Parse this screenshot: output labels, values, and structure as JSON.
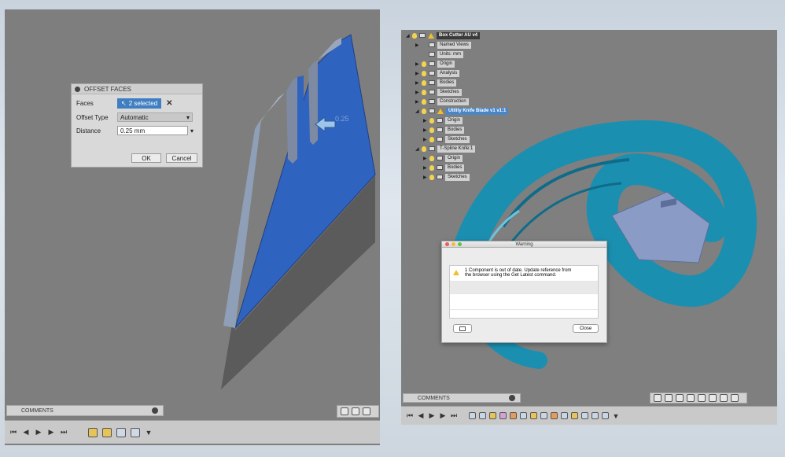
{
  "left": {
    "dialog": {
      "title": "OFFSET FACES",
      "faces_label": "Faces",
      "faces_value": "2 selected",
      "offset_type_label": "Offset Type",
      "offset_type_value": "Automatic",
      "distance_label": "Distance",
      "distance_value": "0.25 mm",
      "ok_label": "OK",
      "cancel_label": "Cancel"
    },
    "manipulator_value": "0.25",
    "comments_label": "COMMENTS"
  },
  "right": {
    "tree": {
      "root": "Box Cutter AU v4",
      "items": [
        {
          "label": "Named Views"
        },
        {
          "label": "Units: mm"
        },
        {
          "label": "Origin"
        },
        {
          "label": "Analysis"
        },
        {
          "label": "Bodies"
        },
        {
          "label": "Sketches"
        },
        {
          "label": "Construction"
        },
        {
          "label": "Utility Knife Blade v1 v1:1"
        },
        {
          "label": "Origin"
        },
        {
          "label": "Bodies"
        },
        {
          "label": "Sketches"
        },
        {
          "label": "T-Spline Knife:1"
        },
        {
          "label": "Origin"
        },
        {
          "label": "Bodies"
        },
        {
          "label": "Sketches"
        }
      ]
    },
    "warning": {
      "title": "Warning",
      "message_line1": "1 Component is out of date. Update reference from",
      "message_line2": "the browser using the Get Latest command.",
      "close_label": "Close"
    },
    "comments_label": "COMMENTS"
  },
  "colors": {
    "accent_blue": "#3f7fc1",
    "model_teal": "#1b8fb0",
    "blade_blue": "#2f63c0",
    "warning_yellow": "#f0c02a"
  }
}
